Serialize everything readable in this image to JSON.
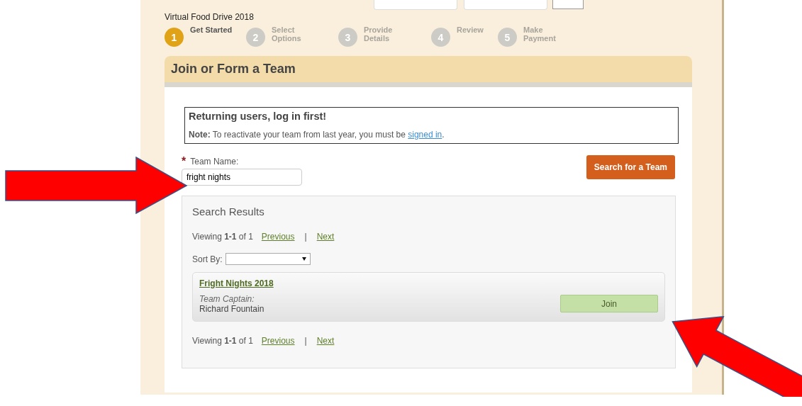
{
  "event_title": "Virtual Food Drive 2018",
  "steps": [
    {
      "number": "1",
      "label": "Get Started",
      "selected": true
    },
    {
      "number": "2",
      "label": "Select Options",
      "selected": false
    },
    {
      "number": "3",
      "label": "Provide Details",
      "selected": false
    },
    {
      "number": "4",
      "label": "Review",
      "selected": false
    },
    {
      "number": "5",
      "label": "Make Payment",
      "selected": false
    }
  ],
  "panel_title": "Join or Form a Team",
  "notice": {
    "heading": "Returning users, log in first!",
    "note": "**Note:** To reactivate your team from last year, you must be",
    "link": "signed in",
    "end": "."
  },
  "team_name": {
    "required_mark": "*",
    "label": "Team Name:",
    "value": "fright nights"
  },
  "search_button": "Search for a Team",
  "results": {
    "title": "Search Results",
    "pager_top": {
      "viewing": "Viewing **1-1** of 1",
      "previous": "Previous",
      "separator": "|",
      "next": "Next"
    },
    "sort_label": "Sort By:",
    "teams": [
      {
        "name": "Fright Nights 2018",
        "captain_label": "Team Captain:",
        "captain": "Richard Fountain",
        "button": "Join"
      }
    ],
    "pager_bottom": {
      "viewing": "Viewing **1-1** of 1",
      "previous": "Previous",
      "separator": "|",
      "next": "Next"
    }
  }
}
